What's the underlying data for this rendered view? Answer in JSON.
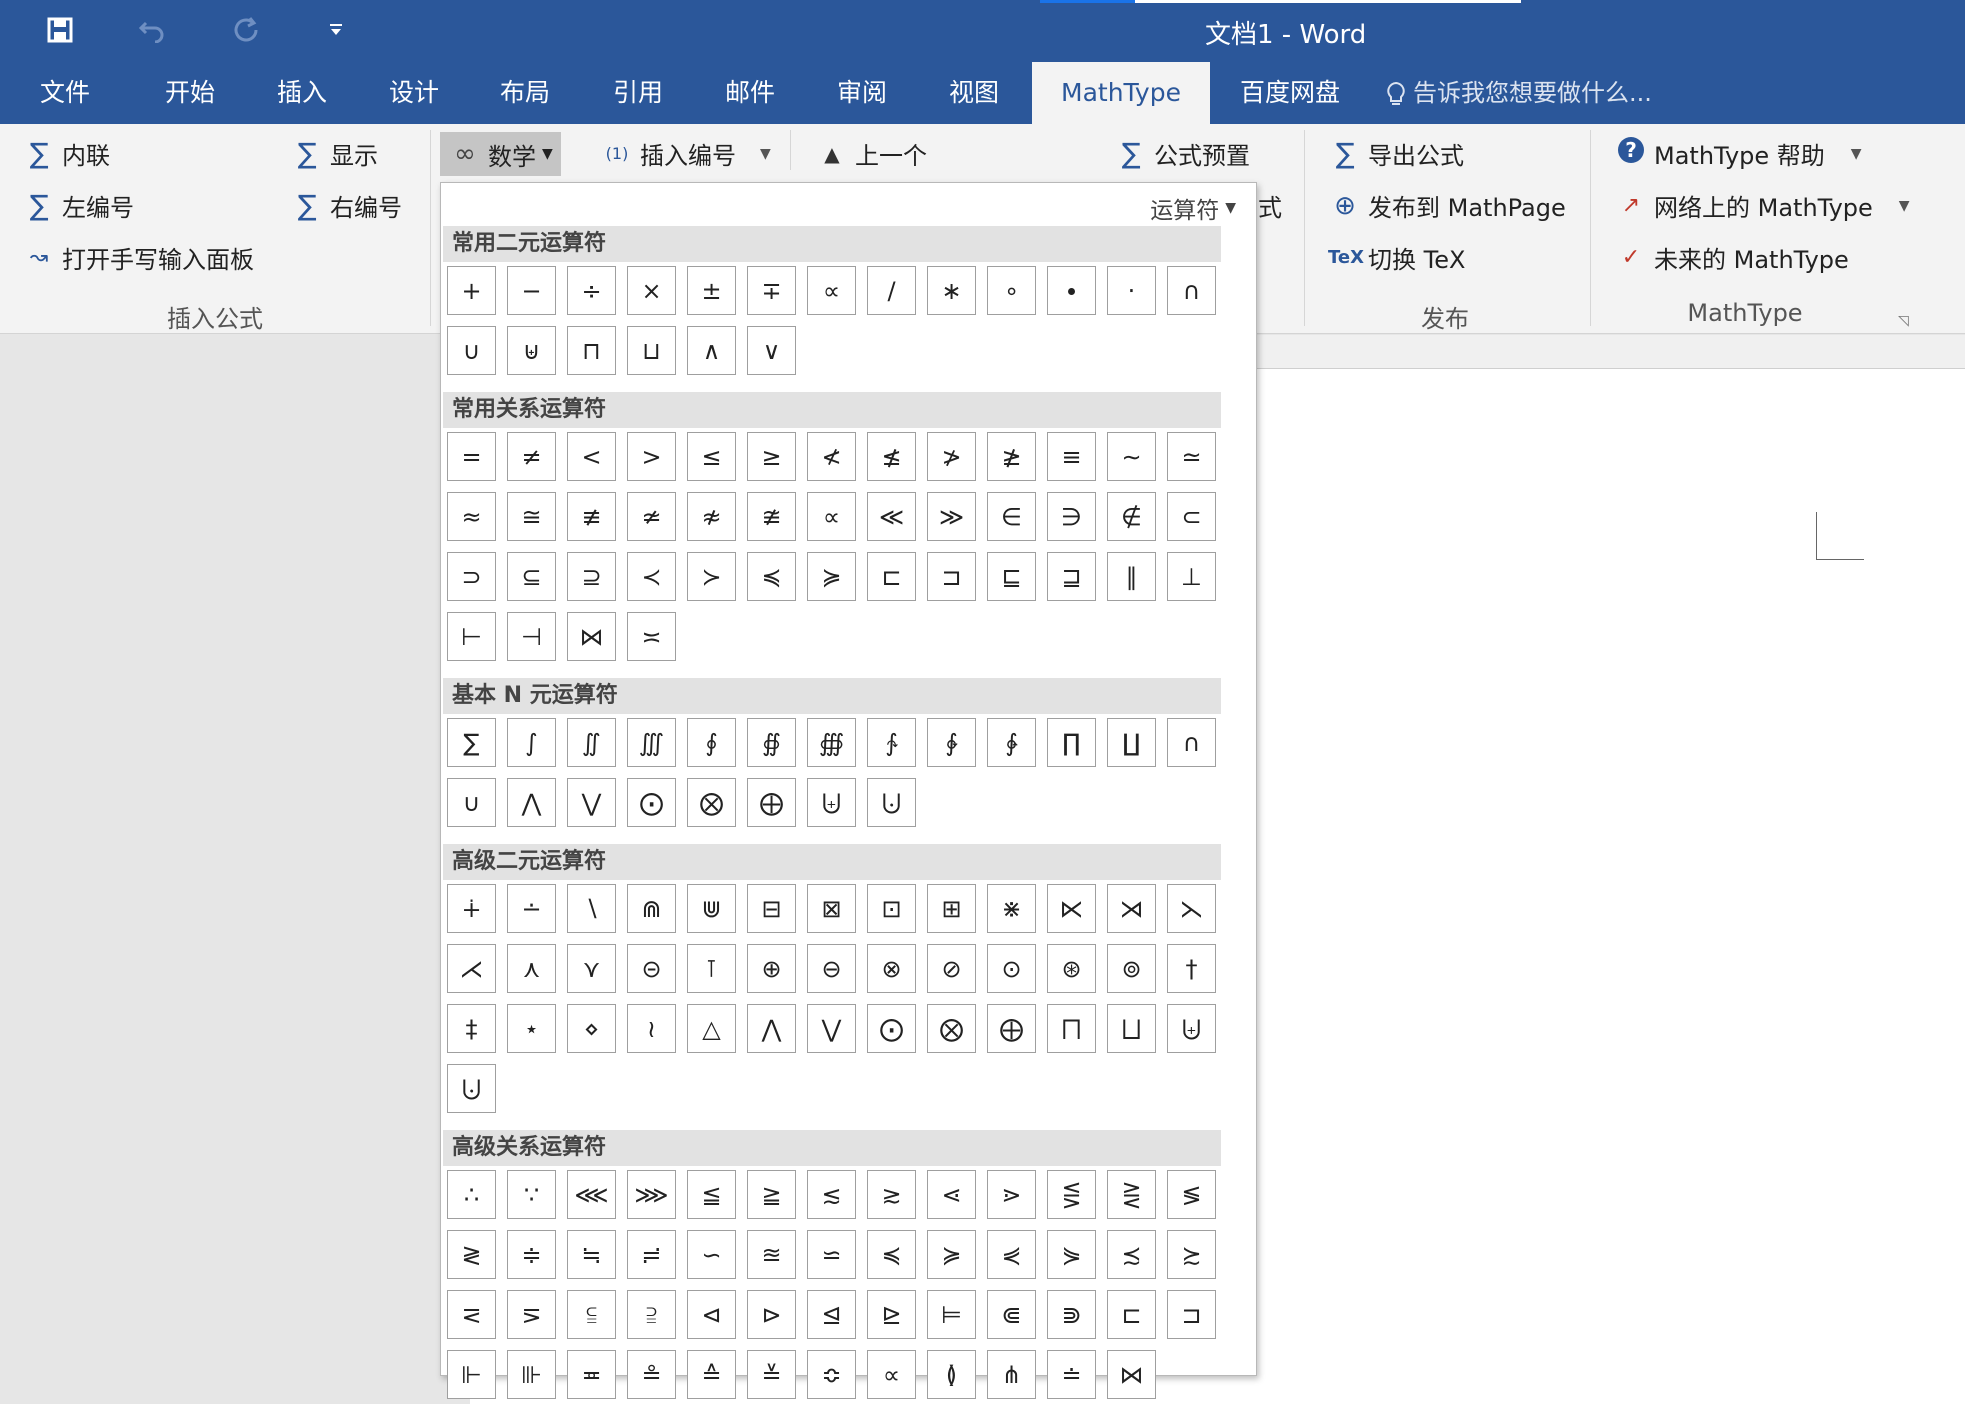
{
  "app": {
    "doc_title": "文档1 - Word",
    "qat": {
      "save_icon": "save-icon",
      "undo_icon": "undo-icon",
      "redo_icon": "redo-icon",
      "customize_icon": "customize-qat-icon"
    }
  },
  "tabs": [
    {
      "label": "文件",
      "active": false
    },
    {
      "label": "开始",
      "active": false
    },
    {
      "label": "插入",
      "active": false
    },
    {
      "label": "设计",
      "active": false
    },
    {
      "label": "布局",
      "active": false
    },
    {
      "label": "引用",
      "active": false
    },
    {
      "label": "邮件",
      "active": false
    },
    {
      "label": "审阅",
      "active": false
    },
    {
      "label": "视图",
      "active": false
    },
    {
      "label": "MathType",
      "active": true
    },
    {
      "label": "百度网盘",
      "active": false
    }
  ],
  "tell_me": "告诉我您想要做什么...",
  "ribbon": {
    "insert_equation": {
      "inline": "内联",
      "display": "显示",
      "left_number": "左编号",
      "right_number": "右编号",
      "handwriting": "打开手写输入面板",
      "group_label": "插入公式"
    },
    "symbols": {
      "math": "数学",
      "insert_number": "插入编号",
      "previous": "上一个",
      "formula_preset": "公式预置",
      "partial_hidden": "式"
    },
    "publish": {
      "export": "导出公式",
      "publish_mathpage": "发布到 MathPage",
      "toggle_tex": "切换 TeX",
      "group_label": "发布"
    },
    "mathtype": {
      "help": "MathType 帮助",
      "online": "网络上的 MathType",
      "future": "未来的 MathType",
      "group_label": "MathType"
    }
  },
  "dropdown": {
    "header": "运算符",
    "categories": [
      {
        "title": "常用二元运算符",
        "symbols": [
          "+",
          "−",
          "÷",
          "×",
          "±",
          "∓",
          "∝",
          "∕",
          "∗",
          "∘",
          "∙",
          "⋅",
          "∩",
          "∪",
          "⊎",
          "⊓",
          "⊔",
          "∧",
          "∨"
        ]
      },
      {
        "title": "常用关系运算符",
        "symbols": [
          "=",
          "≠",
          "<",
          ">",
          "≤",
          "≥",
          "≮",
          "≰",
          "≯",
          "≱",
          "≡",
          "∼",
          "≃",
          "≈",
          "≅",
          "≢",
          "≄",
          "≉",
          "≇",
          "∝",
          "≪",
          "≫",
          "∈",
          "∋",
          "∉",
          "⊂",
          "⊃",
          "⊆",
          "⊇",
          "≺",
          "≻",
          "≼",
          "≽",
          "⊏",
          "⊐",
          "⊑",
          "⊒",
          "∥",
          "⊥",
          "⊢",
          "⊣",
          "⋈",
          "≍"
        ]
      },
      {
        "title": "基本 N 元运算符",
        "symbols": [
          "∑",
          "∫",
          "∬",
          "∭",
          "∮",
          "∯",
          "∰",
          "∱",
          "∲",
          "∳",
          "∏",
          "∐",
          "∩",
          "∪",
          "⋀",
          "⋁",
          "⨀",
          "⨂",
          "⨁",
          "⨄",
          "⨃"
        ]
      },
      {
        "title": "高级二元运算符",
        "symbols": [
          "∔",
          "∸",
          "∖",
          "⋒",
          "⋓",
          "⊟",
          "⊠",
          "⊡",
          "⊞",
          "⋇",
          "⋉",
          "⋊",
          "⋋",
          "⋌",
          "⋏",
          "⋎",
          "⊝",
          "⊺",
          "⊕",
          "⊖",
          "⊗",
          "⊘",
          "⊙",
          "⊛",
          "⊚",
          "†",
          "‡",
          "⋆",
          "⋄",
          "≀",
          "△",
          "⋀",
          "⋁",
          "⨀",
          "⨂",
          "⨁",
          "⨅",
          "⨆",
          "⨄",
          "⨃"
        ]
      },
      {
        "title": "高级关系运算符",
        "symbols": [
          "∴",
          "∵",
          "⋘",
          "⋙",
          "≦",
          "≧",
          "≲",
          "≳",
          "⋖",
          "⋗",
          "⋚",
          "⋛",
          "≶",
          "≷",
          "≑",
          "≒",
          "≓",
          "∽",
          "≊",
          "⋍",
          "≼",
          "≽",
          "⋞",
          "⋟",
          "≾",
          "≿",
          "⋜",
          "⋝",
          "⫅",
          "⫆",
          "⊲",
          "⊳",
          "⊴",
          "⊵",
          "⊨",
          "⋐",
          "⋑",
          "⊏",
          "⊐",
          "⊩",
          "⊪",
          "≖",
          "≗",
          "≙",
          "≚",
          "≎",
          "∝",
          "≬",
          "⋔",
          "≐",
          "⋈"
        ]
      }
    ]
  }
}
